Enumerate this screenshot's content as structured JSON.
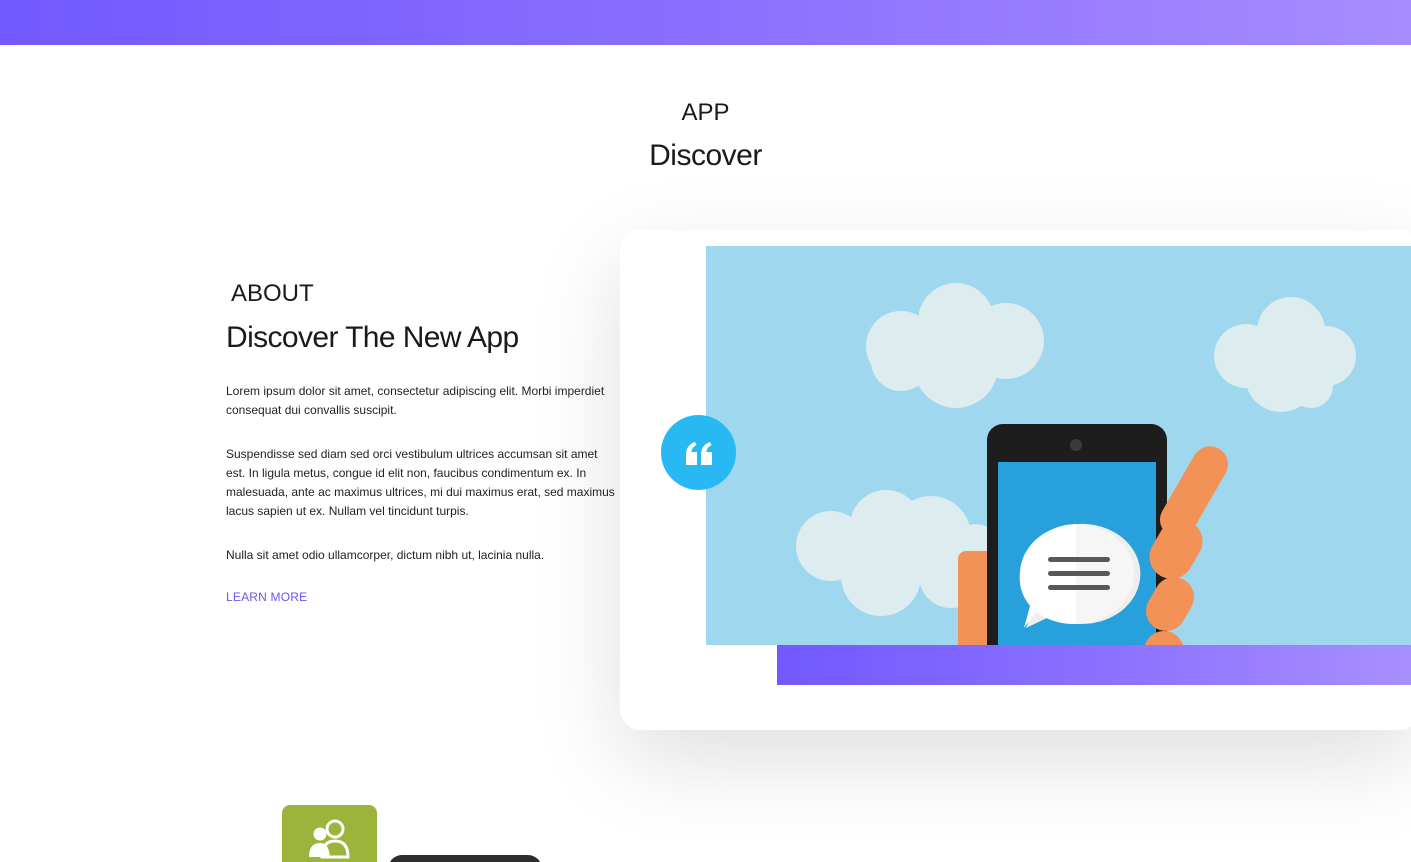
{
  "header": {
    "kicker": "APP",
    "title": "Discover"
  },
  "about": {
    "kicker": "ABOUT",
    "title": "Discover The New App",
    "paragraphs": [
      "Lorem ipsum dolor sit amet, consectetur adipiscing elit. Morbi imperdiet consequat dui convallis suscipit.",
      "Suspendisse sed diam sed orci vestibulum ultrices accumsan sit amet est. In ligula metus, congue id elit non, faucibus condimentum ex. In malesuada, ante ac maximus ultrices, mi dui maximus erat, sed maximus lacus sapien ut ex. Nullam vel tincidunt turpis.",
      "Nulla sit amet odio ullamcorper, dictum nibh ut, lacinia nulla."
    ],
    "cta_label": "LEARN MORE"
  },
  "icons": {
    "quote": "quote-icon",
    "users": "users-icon",
    "hero": "phone-chat-illustration"
  },
  "colors": {
    "brand_gradient_start": "#7259ff",
    "brand_gradient_end": "#a88fff",
    "link": "#6c55f0",
    "quote_badge": "#29b9f2",
    "hero_sky": "#9fd7ee",
    "feature_icon_bg": "#9cb43b"
  }
}
